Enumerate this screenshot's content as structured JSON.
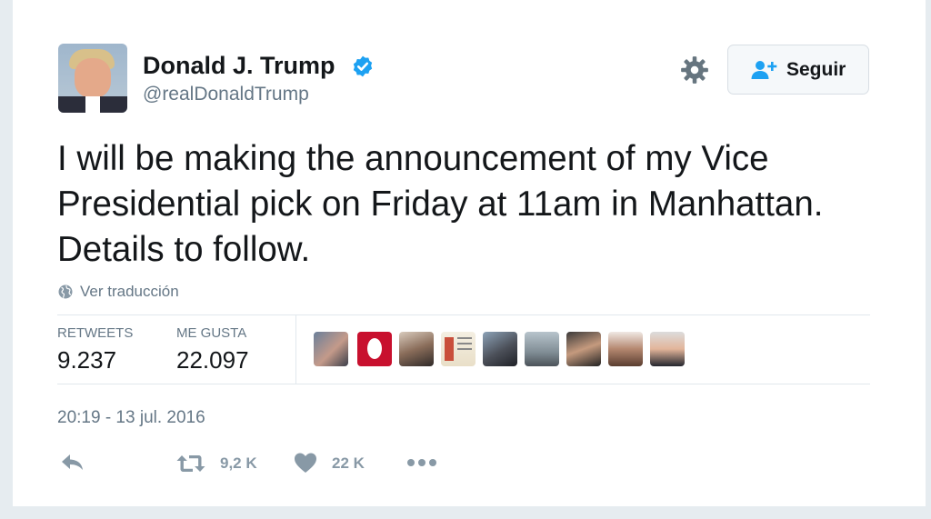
{
  "user": {
    "name": "Donald J. Trump",
    "handle": "@realDonaldTrump",
    "verified": true,
    "verified_icon": "verified-badge-icon"
  },
  "header": {
    "follow_label": "Seguir",
    "follow_icon": "add-user-icon",
    "settings_icon": "gear-icon"
  },
  "tweet": {
    "text": "I will be making the announcement of my Vice Presidential pick on Friday at 11am in Manhattan. Details to follow.",
    "translate_label": "Ver traducción",
    "translate_icon": "globe-icon",
    "timestamp": "20:19 - 13 jul. 2016"
  },
  "stats": {
    "retweets_label": "RETWEETS",
    "retweets_value": "9.237",
    "likes_label": "ME GUSTA",
    "likes_value": "22.097"
  },
  "liked_by_avatars_count": 9,
  "actions": {
    "reply_icon": "reply-icon",
    "retweet_icon": "retweet-icon",
    "retweet_count": "9,2 K",
    "like_icon": "heart-icon",
    "like_count": "22 K",
    "more_icon": "more-dots-icon"
  },
  "colors": {
    "accent": "#1da1f2",
    "text": "#14171a",
    "secondary": "#657786",
    "action": "#8899a6",
    "border": "#e1e8ed"
  }
}
